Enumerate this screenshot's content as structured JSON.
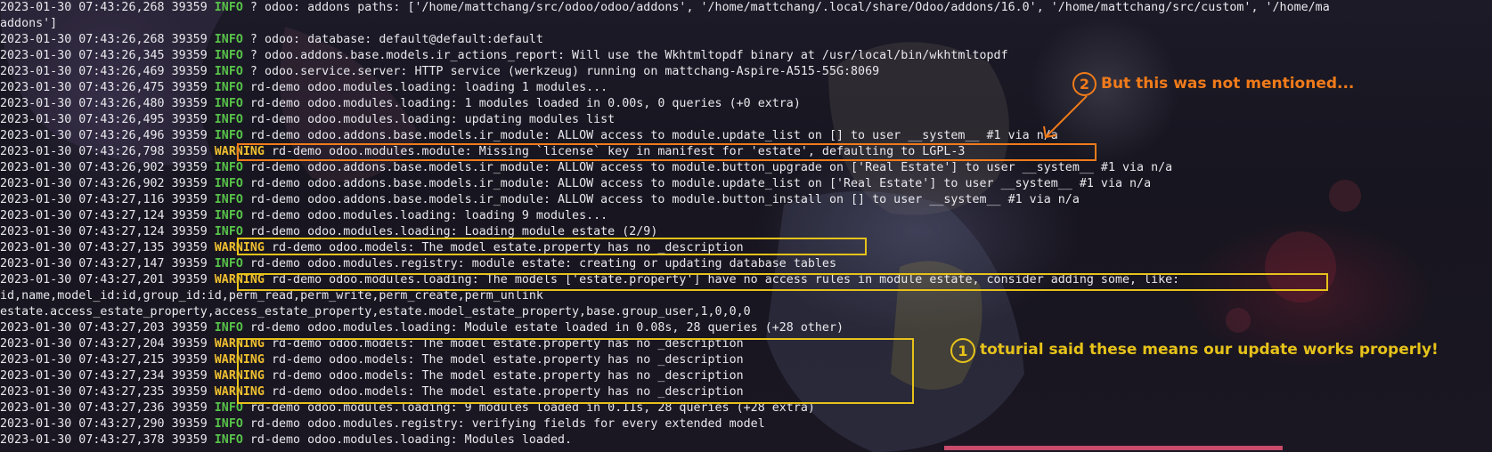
{
  "terminal": {
    "lines": [
      {
        "pre": "2023-01-30 07:43:26,268 39359 ",
        "level": "INFO",
        "msg": " ? odoo: addons paths: ['/home/mattchang/src/odoo/odoo/addons', '/home/mattchang/.local/share/Odoo/addons/16.0', '/home/mattchang/src/custom', '/home/ma"
      },
      {
        "pre": "addons']",
        "level": "",
        "msg": ""
      },
      {
        "pre": "2023-01-30 07:43:26,268 39359 ",
        "level": "INFO",
        "msg": " ? odoo: database: default@default:default"
      },
      {
        "pre": "2023-01-30 07:43:26,345 39359 ",
        "level": "INFO",
        "msg": " ? odoo.addons.base.models.ir_actions_report: Will use the Wkhtmltopdf binary at /usr/local/bin/wkhtmltopdf"
      },
      {
        "pre": "2023-01-30 07:43:26,469 39359 ",
        "level": "INFO",
        "msg": " ? odoo.service.server: HTTP service (werkzeug) running on mattchang-Aspire-A515-55G:8069"
      },
      {
        "pre": "2023-01-30 07:43:26,475 39359 ",
        "level": "INFO",
        "msg": " rd-demo odoo.modules.loading: loading 1 modules..."
      },
      {
        "pre": "2023-01-30 07:43:26,480 39359 ",
        "level": "INFO",
        "msg": " rd-demo odoo.modules.loading: 1 modules loaded in 0.00s, 0 queries (+0 extra)"
      },
      {
        "pre": "2023-01-30 07:43:26,495 39359 ",
        "level": "INFO",
        "msg": " rd-demo odoo.modules.loading: updating modules list"
      },
      {
        "pre": "2023-01-30 07:43:26,496 39359 ",
        "level": "INFO",
        "msg": " rd-demo odoo.addons.base.models.ir_module: ALLOW access to module.update_list on [] to user __system__ #1 via n/a"
      },
      {
        "pre": "2023-01-30 07:43:26,798 39359 ",
        "level": "WARNING",
        "msg": " rd-demo odoo.modules.module: Missing `license` key in manifest for 'estate', defaulting to LGPL-3"
      },
      {
        "pre": "2023-01-30 07:43:26,902 39359 ",
        "level": "INFO",
        "msg": " rd-demo odoo.addons.base.models.ir_module: ALLOW access to module.button_upgrade on ['Real Estate'] to user __system__ #1 via n/a"
      },
      {
        "pre": "2023-01-30 07:43:26,902 39359 ",
        "level": "INFO",
        "msg": " rd-demo odoo.addons.base.models.ir_module: ALLOW access to module.update_list on ['Real Estate'] to user __system__ #1 via n/a"
      },
      {
        "pre": "2023-01-30 07:43:27,116 39359 ",
        "level": "INFO",
        "msg": " rd-demo odoo.addons.base.models.ir_module: ALLOW access to module.button_install on [] to user __system__ #1 via n/a"
      },
      {
        "pre": "2023-01-30 07:43:27,124 39359 ",
        "level": "INFO",
        "msg": " rd-demo odoo.modules.loading: loading 9 modules..."
      },
      {
        "pre": "2023-01-30 07:43:27,124 39359 ",
        "level": "INFO",
        "msg": " rd-demo odoo.modules.loading: Loading module estate (2/9)"
      },
      {
        "pre": "2023-01-30 07:43:27,135 39359 ",
        "level": "WARNING",
        "msg": " rd-demo odoo.models: The model estate.property has no _description"
      },
      {
        "pre": "2023-01-30 07:43:27,147 39359 ",
        "level": "INFO",
        "msg": " rd-demo odoo.modules.registry: module estate: creating or updating database tables"
      },
      {
        "pre": "2023-01-30 07:43:27,201 39359 ",
        "level": "WARNING",
        "msg": " rd-demo odoo.modules.loading: The models ['estate.property'] have no access rules in module estate, consider adding some, like:"
      },
      {
        "pre": "id,name,model_id:id,group_id:id,perm_read,perm_write,perm_create,perm_unlink",
        "level": "",
        "msg": ""
      },
      {
        "pre": "estate.access_estate_property,access_estate_property,estate.model_estate_property,base.group_user,1,0,0,0",
        "level": "",
        "msg": ""
      },
      {
        "pre": "2023-01-30 07:43:27,203 39359 ",
        "level": "INFO",
        "msg": " rd-demo odoo.modules.loading: Module estate loaded in 0.08s, 28 queries (+28 other)"
      },
      {
        "pre": "2023-01-30 07:43:27,204 39359 ",
        "level": "WARNING",
        "msg": " rd-demo odoo.models: The model estate.property has no _description"
      },
      {
        "pre": "2023-01-30 07:43:27,215 39359 ",
        "level": "WARNING",
        "msg": " rd-demo odoo.models: The model estate.property has no _description"
      },
      {
        "pre": "2023-01-30 07:43:27,234 39359 ",
        "level": "WARNING",
        "msg": " rd-demo odoo.models: The model estate.property has no _description"
      },
      {
        "pre": "2023-01-30 07:43:27,235 39359 ",
        "level": "WARNING",
        "msg": " rd-demo odoo.models: The model estate.property has no _description"
      },
      {
        "pre": "2023-01-30 07:43:27,236 39359 ",
        "level": "INFO",
        "msg": " rd-demo odoo.modules.loading: 9 modules loaded in 0.11s, 28 queries (+28 extra)"
      },
      {
        "pre": "2023-01-30 07:43:27,290 39359 ",
        "level": "INFO",
        "msg": " rd-demo odoo.modules.registry: verifying fields for every extended model"
      },
      {
        "pre": "2023-01-30 07:43:27,378 39359 ",
        "level": "INFO",
        "msg": " rd-demo odoo.modules.loading: Modules loaded."
      }
    ]
  },
  "annotations": {
    "note1": {
      "number": "1",
      "text": "toturial said these means our update works properly!"
    },
    "note2": {
      "number": "2",
      "text": "But this was not mentioned..."
    }
  },
  "colors": {
    "info": "#58c24a",
    "warning": "#f0c030",
    "text": "#e8e8ec",
    "annotation_orange": "#f07b1a",
    "annotation_yellow": "#e6c21a",
    "scrollbar": "#c94a6a"
  }
}
